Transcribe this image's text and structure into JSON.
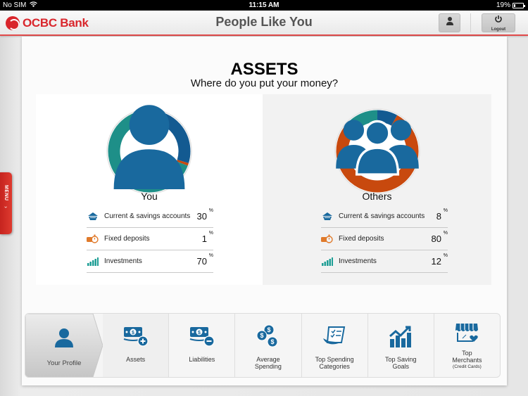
{
  "status_bar": {
    "carrier": "No SIM",
    "time": "11:15 AM",
    "battery": "19%",
    "battery_level": 0.19
  },
  "header": {
    "brand": "OCBC Bank",
    "title": "People Like You",
    "logout_label": "Logout"
  },
  "side_menu": {
    "label": "MENU",
    "chevron": "›"
  },
  "section": {
    "title": "ASSETS",
    "subtitle": "Where do you put your money?"
  },
  "colors": {
    "brand_red": "#d9262c",
    "current_savings": "#135a91",
    "fixed_deposits": "#c8490e",
    "investments": "#1e8f88",
    "icon_blue": "#19699e"
  },
  "panels": {
    "you": {
      "label": "You",
      "rows": [
        {
          "label": "Current & savings accounts",
          "value": "30",
          "unit": "%",
          "icon": "bank-icon"
        },
        {
          "label": "Fixed deposits",
          "value": "1",
          "unit": "%",
          "icon": "coins-timer-icon"
        },
        {
          "label": "Investments",
          "value": "70",
          "unit": "%",
          "icon": "bar-chart-icon"
        }
      ]
    },
    "others": {
      "label": "Others",
      "rows": [
        {
          "label": "Current & savings accounts",
          "value": "8",
          "unit": "%",
          "icon": "bank-icon"
        },
        {
          "label": "Fixed deposits",
          "value": "80",
          "unit": "%",
          "icon": "coins-timer-icon"
        },
        {
          "label": "Investments",
          "value": "12",
          "unit": "%",
          "icon": "bar-chart-icon"
        }
      ]
    }
  },
  "chart_data": [
    {
      "type": "pie",
      "title": "You",
      "categories": [
        "Current & savings accounts",
        "Fixed deposits",
        "Investments"
      ],
      "values": [
        30,
        1,
        70
      ],
      "unit": "%"
    },
    {
      "type": "pie",
      "title": "Others",
      "categories": [
        "Current & savings accounts",
        "Fixed deposits",
        "Investments"
      ],
      "values": [
        8,
        80,
        12
      ],
      "unit": "%"
    }
  ],
  "nav": {
    "profile": {
      "label": "Your Profile"
    },
    "items": [
      {
        "label": "Assets",
        "sub": ""
      },
      {
        "label": "Liabilities",
        "sub": ""
      },
      {
        "label": "Average Spending",
        "sub": ""
      },
      {
        "label": "Top Spending Categories",
        "sub": ""
      },
      {
        "label": "Top Saving Goals",
        "sub": ""
      },
      {
        "label": "Top Merchants",
        "sub": "(Credit Cards)"
      }
    ]
  }
}
